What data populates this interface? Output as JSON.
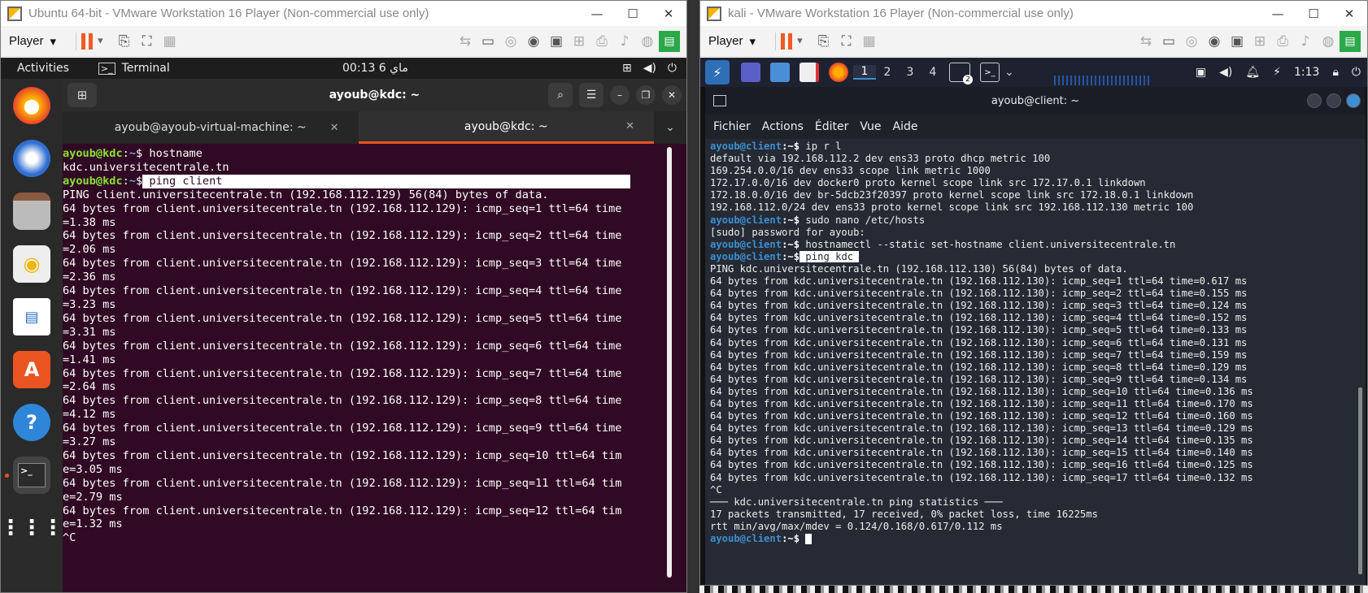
{
  "vm1": {
    "title": "Ubuntu 64-bit - VMware Workstation 16 Player (Non-commercial use only)",
    "player_label": "Player",
    "gnome": {
      "activities": "Activities",
      "app": "Terminal",
      "clock": "00:13  6 ماي"
    },
    "terminal": {
      "title": "ayoub@kdc: ~",
      "tabs": [
        {
          "label": "ayoub@ayoub-virtual-machine: ~"
        },
        {
          "label": "ayoub@kdc: ~"
        }
      ],
      "prompt_user": "ayoub@kdc",
      "prompt_path": "~",
      "cmd1": "hostname",
      "out1": "kdc.universitecentrale.tn",
      "cmd2": " ping client",
      "lines": [
        "PING client.universitecentrale.tn (192.168.112.129) 56(84) bytes of data.",
        "64 bytes from client.universitecentrale.tn (192.168.112.129): icmp_seq=1 ttl=64 time",
        "=1.38 ms",
        "64 bytes from client.universitecentrale.tn (192.168.112.129): icmp_seq=2 ttl=64 time",
        "=2.06 ms",
        "64 bytes from client.universitecentrale.tn (192.168.112.129): icmp_seq=3 ttl=64 time",
        "=2.36 ms",
        "64 bytes from client.universitecentrale.tn (192.168.112.129): icmp_seq=4 ttl=64 time",
        "=3.23 ms",
        "64 bytes from client.universitecentrale.tn (192.168.112.129): icmp_seq=5 ttl=64 time",
        "=3.31 ms",
        "64 bytes from client.universitecentrale.tn (192.168.112.129): icmp_seq=6 ttl=64 time",
        "=1.41 ms",
        "64 bytes from client.universitecentrale.tn (192.168.112.129): icmp_seq=7 ttl=64 time",
        "=2.64 ms",
        "64 bytes from client.universitecentrale.tn (192.168.112.129): icmp_seq=8 ttl=64 time",
        "=4.12 ms",
        "64 bytes from client.universitecentrale.tn (192.168.112.129): icmp_seq=9 ttl=64 time",
        "=3.27 ms",
        "64 bytes from client.universitecentrale.tn (192.168.112.129): icmp_seq=10 ttl=64 tim",
        "e=3.05 ms",
        "64 bytes from client.universitecentrale.tn (192.168.112.129): icmp_seq=11 ttl=64 tim",
        "e=2.79 ms",
        "64 bytes from client.universitecentrale.tn (192.168.112.129): icmp_seq=12 ttl=64 tim",
        "e=1.32 ms",
        "^C"
      ]
    }
  },
  "vm2": {
    "title": "kali - VMware Workstation 16 Player (Non-commercial use only)",
    "player_label": "Player",
    "panel": {
      "workspaces": [
        "1",
        "2",
        "3",
        "4"
      ],
      "clock": "1:13",
      "badge": "2"
    },
    "terminal": {
      "title": "ayoub@client: ~",
      "menu": [
        "Fichier",
        "Actions",
        "Éditer",
        "Vue",
        "Aide"
      ],
      "prompt_user": "ayoub@client",
      "prompt_path": "~",
      "cmd_ip": " ip r l",
      "route_lines": [
        "default via 192.168.112.2 dev ens33 proto dhcp metric 100",
        "169.254.0.0/16 dev ens33 scope link metric 1000",
        "172.17.0.0/16 dev docker0 proto kernel scope link src 172.17.0.1 linkdown",
        "172.18.0.0/16 dev br-5dcb23f20397 proto kernel scope link src 172.18.0.1 linkdown",
        "192.168.112.0/24 dev ens33 proto kernel scope link src 192.168.112.130 metric 100"
      ],
      "cmd_nano": " sudo nano /etc/hosts",
      "sudo_prompt": "[sudo] password for ayoub:",
      "cmd_host": " hostnamectl --static set-hostname client.universitecentrale.tn",
      "cmd_ping": " ping kdc ",
      "ping_lines": [
        "PING kdc.universitecentrale.tn (192.168.112.130) 56(84) bytes of data.",
        "64 bytes from kdc.universitecentrale.tn (192.168.112.130): icmp_seq=1 ttl=64 time=0.617 ms",
        "64 bytes from kdc.universitecentrale.tn (192.168.112.130): icmp_seq=2 ttl=64 time=0.155 ms",
        "64 bytes from kdc.universitecentrale.tn (192.168.112.130): icmp_seq=3 ttl=64 time=0.124 ms",
        "64 bytes from kdc.universitecentrale.tn (192.168.112.130): icmp_seq=4 ttl=64 time=0.152 ms",
        "64 bytes from kdc.universitecentrale.tn (192.168.112.130): icmp_seq=5 ttl=64 time=0.133 ms",
        "64 bytes from kdc.universitecentrale.tn (192.168.112.130): icmp_seq=6 ttl=64 time=0.131 ms",
        "64 bytes from kdc.universitecentrale.tn (192.168.112.130): icmp_seq=7 ttl=64 time=0.159 ms",
        "64 bytes from kdc.universitecentrale.tn (192.168.112.130): icmp_seq=8 ttl=64 time=0.129 ms",
        "64 bytes from kdc.universitecentrale.tn (192.168.112.130): icmp_seq=9 ttl=64 time=0.134 ms",
        "64 bytes from kdc.universitecentrale.tn (192.168.112.130): icmp_seq=10 ttl=64 time=0.136 ms",
        "64 bytes from kdc.universitecentrale.tn (192.168.112.130): icmp_seq=11 ttl=64 time=0.170 ms",
        "64 bytes from kdc.universitecentrale.tn (192.168.112.130): icmp_seq=12 ttl=64 time=0.160 ms",
        "64 bytes from kdc.universitecentrale.tn (192.168.112.130): icmp_seq=13 ttl=64 time=0.129 ms",
        "64 bytes from kdc.universitecentrale.tn (192.168.112.130): icmp_seq=14 ttl=64 time=0.135 ms",
        "64 bytes from kdc.universitecentrale.tn (192.168.112.130): icmp_seq=15 ttl=64 time=0.140 ms",
        "64 bytes from kdc.universitecentrale.tn (192.168.112.130): icmp_seq=16 ttl=64 time=0.125 ms",
        "64 bytes from kdc.universitecentrale.tn (192.168.112.130): icmp_seq=17 ttl=64 time=0.132 ms",
        "^C",
        "─── kdc.universitecentrale.tn ping statistics ───",
        "17 packets transmitted, 17 received, 0% packet loss, time 16225ms",
        "rtt min/avg/max/mdev = 0.124/0.168/0.617/0.112 ms"
      ]
    }
  }
}
